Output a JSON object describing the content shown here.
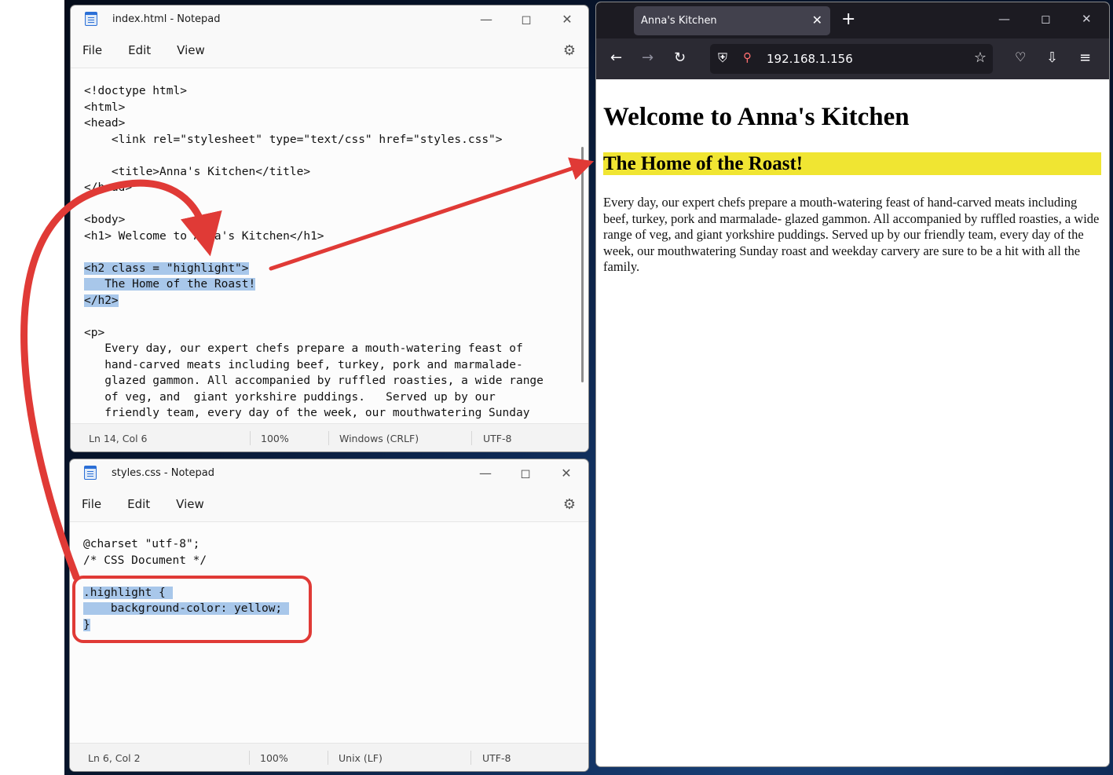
{
  "notepad_html": {
    "title": "index.html - Notepad",
    "menu": [
      "File",
      "Edit",
      "View"
    ],
    "code_lines": [
      "<!doctype html>",
      "<html>",
      "<head>",
      "    <link rel=\"stylesheet\" type=\"text/css\" href=\"styles.css\">",
      "",
      "    <title>Anna's Kitchen</title>",
      "</head>",
      "",
      "<body>",
      "<h1> Welcome to Anna's Kitchen</h1>",
      ""
    ],
    "highlight_lines": [
      "<h2 class = \"highlight\">",
      "   The Home of the Roast!",
      "</h2>"
    ],
    "code_lines_after": [
      "",
      "<p>",
      "   Every day, our expert chefs prepare a mouth-watering feast of",
      "   hand-carved meats including beef, turkey, pork and marmalade-",
      "   glazed gammon. All accompanied by ruffled roasties, a wide range",
      "   of veg, and  giant yorkshire puddings.   Served up by our",
      "   friendly team, every day of the week, our mouthwatering Sunday"
    ],
    "status": {
      "position": "Ln 14, Col 6",
      "zoom": "100%",
      "line_ending": "Windows (CRLF)",
      "encoding": "UTF-8"
    }
  },
  "notepad_css": {
    "title": "styles.css - Notepad",
    "menu": [
      "File",
      "Edit",
      "View"
    ],
    "code_lines": [
      "@charset \"utf-8\";",
      "/* CSS Document */",
      ""
    ],
    "highlight_lines": [
      ".highlight { ",
      "    background-color: yellow; ",
      "}"
    ],
    "status": {
      "position": "Ln 6, Col 2",
      "zoom": "100%",
      "line_ending": "Unix (LF)",
      "encoding": "UTF-8"
    }
  },
  "browser": {
    "tab_title": "Anna's Kitchen",
    "url": "192.168.1.156",
    "page": {
      "h1": "Welcome to Anna's Kitchen",
      "h2": "The Home of the Roast!",
      "paragraph": "Every day, our expert chefs prepare a mouth-watering feast of hand-carved meats including beef, turkey, pork and marmalade- glazed gammon. All accompanied by ruffled roasties, a wide range of veg, and giant yorkshire puddings. Served up by our friendly team, every day of the week, our mouthwatering Sunday roast and weekday carvery are sure to be a hit with all the family."
    }
  },
  "colors": {
    "annotation_red": "#e03a36",
    "highlight_yellow": "#f0e532",
    "selection_blue": "#a8c7ea"
  }
}
